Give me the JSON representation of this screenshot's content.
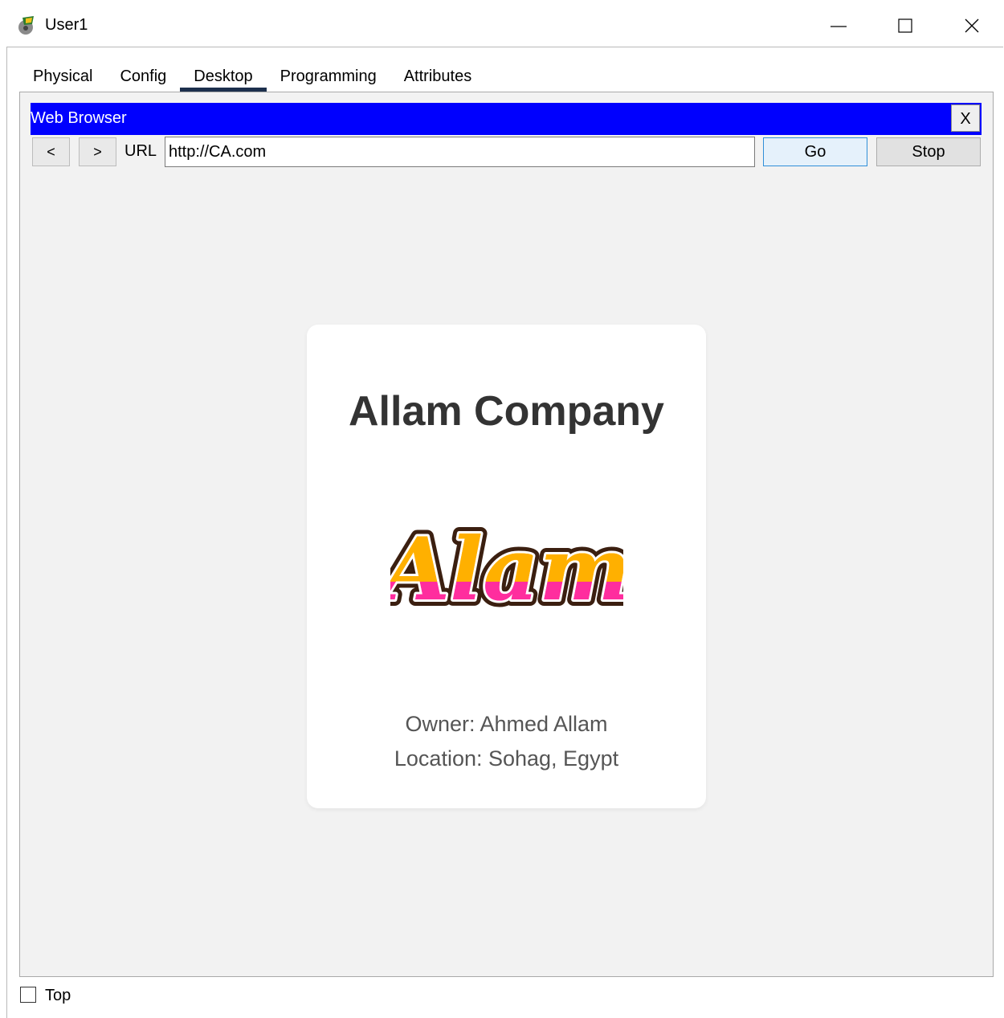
{
  "window": {
    "title": "User1",
    "icon": "packet-tracer-pc-icon"
  },
  "tabs": [
    {
      "label": "Physical",
      "active": false
    },
    {
      "label": "Config",
      "active": false
    },
    {
      "label": "Desktop",
      "active": true
    },
    {
      "label": "Programming",
      "active": false
    },
    {
      "label": "Attributes",
      "active": false
    }
  ],
  "browser": {
    "title": "Web Browser",
    "close_label": "X",
    "back_label": "<",
    "forward_label": ">",
    "url_label": "URL",
    "url_value": "http://CA.com",
    "go_label": "Go",
    "stop_label": "Stop",
    "title_color": "#0000fe"
  },
  "page": {
    "heading": "Allam Company",
    "logo_text": "Alam",
    "owner": "Owner: Ahmed Allam",
    "location": "Location: Sohag, Egypt"
  },
  "footer": {
    "top_label": "Top",
    "top_checked": false
  }
}
